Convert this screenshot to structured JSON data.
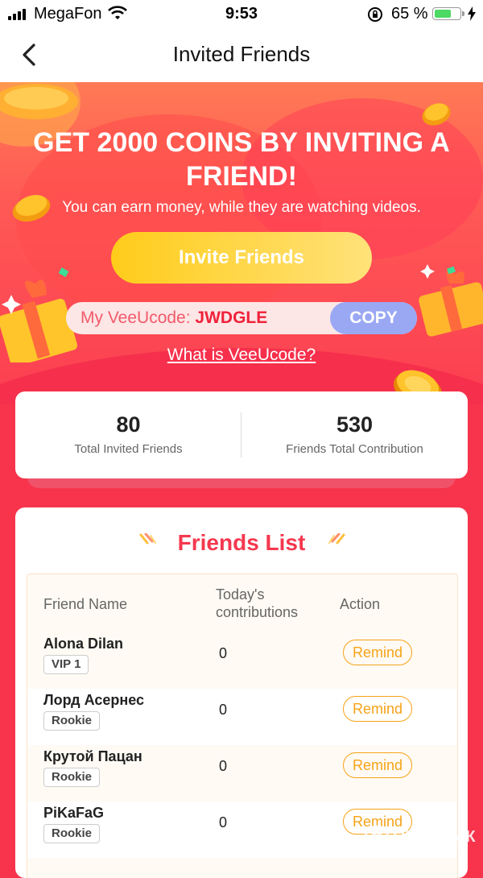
{
  "status_bar": {
    "carrier": "MegaFon",
    "time": "9:53",
    "battery_percent": "65 %",
    "battery_level": 0.65
  },
  "nav": {
    "title": "Invited Friends"
  },
  "hero": {
    "title": "GET 2000 COINS BY INVITING A FRIEND!",
    "subtitle": "You can earn money, while they are watching videos.",
    "invite_button": "Invite Friends",
    "code_label": "My VeeUcode: ",
    "code_value": "JWDGLE",
    "copy_button": "COPY",
    "what_link": "What is VeeUcode?"
  },
  "stats": {
    "invited_count": "80",
    "invited_label": "Total Invited Friends",
    "contribution": "530",
    "contribution_label": "Friends Total Contribution"
  },
  "friends_list": {
    "title": "Friends List",
    "headers": {
      "name": "Friend Name",
      "today_line1": "Today's",
      "today_line2": "contributions",
      "action": "Action"
    },
    "rows": [
      {
        "name": "Alona Dilan",
        "badge": "VIP 1",
        "today": "0",
        "action": "Remind"
      },
      {
        "name": "Лорд Асернес",
        "badge": "Rookie",
        "today": "0",
        "action": "Remind"
      },
      {
        "name": "Крутой Пацан",
        "badge": "Rookie",
        "today": "0",
        "action": "Remind"
      },
      {
        "name": "PiKaFaG",
        "badge": "Rookie",
        "today": "0",
        "action": "Remind"
      }
    ]
  },
  "watermark": "ОТЗОВИК",
  "colors": {
    "primary": "#f5384f",
    "invite": "#ffcc1a",
    "copy": "#9aa8f4",
    "remind": "#f6a317"
  }
}
